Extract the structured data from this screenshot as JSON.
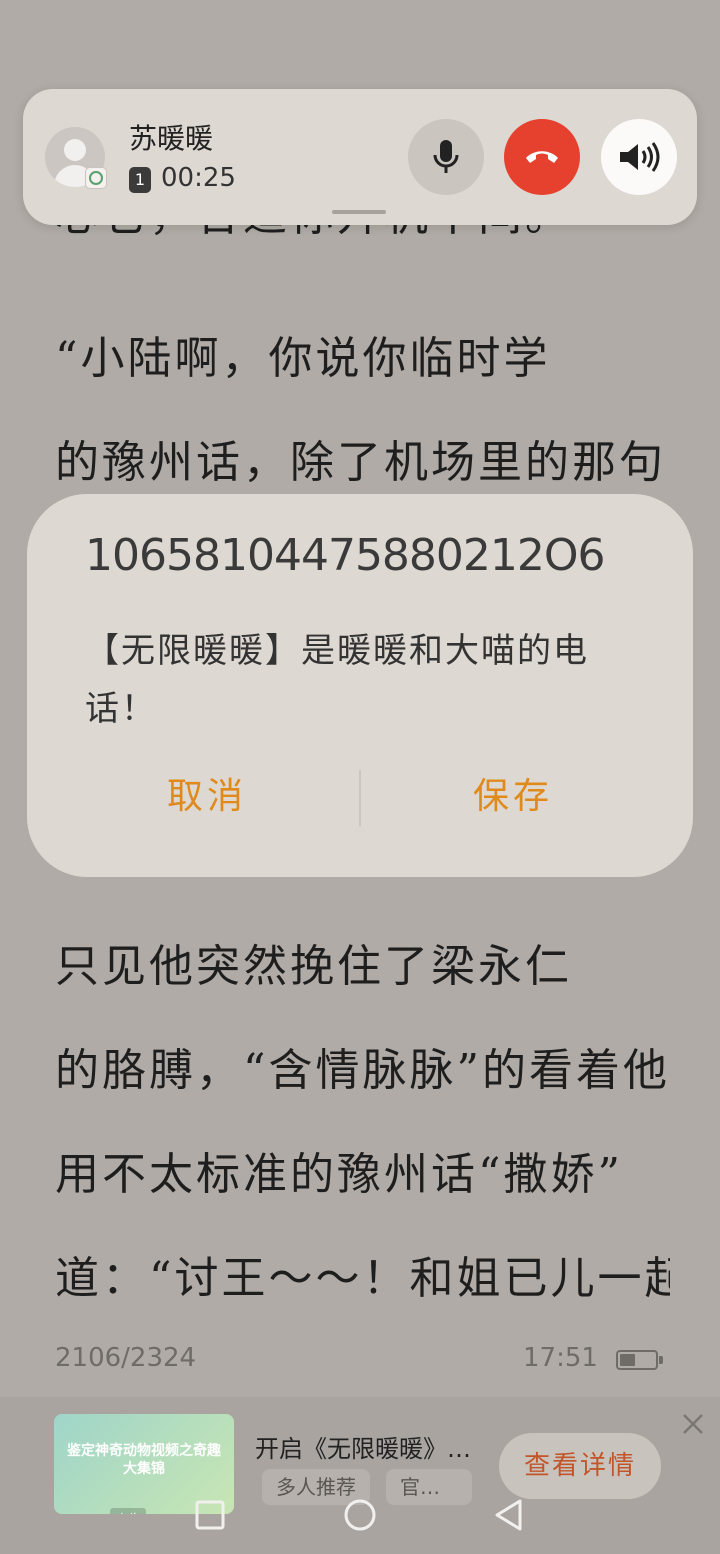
{
  "reader": {
    "line_0": "心它，合适你升机中间。",
    "line_1": "  “小陆啊，你说你临时学",
    "line_2": "的豫州话，除了机场里的那句，",
    "line_3": "  只见他突然挽住了梁永仁",
    "line_4": "的胳膊，“含情脉脉”的看着他，",
    "line_5": "用不太标准的豫州话“撒娇”",
    "line_6": "道：“讨王～～！和姐已儿一起"
  },
  "call": {
    "caller_name": "苏暖暖",
    "sim_slot": "1",
    "timer": "00:25",
    "icons": [
      "avatar-icon",
      "microphone-icon",
      "hang-up-icon",
      "speaker-icon"
    ],
    "hangup_color": "#e6412e"
  },
  "dialog": {
    "number": "10658104475880212O6",
    "message": "【无限暖暖】是暖暖和大喵的电话！",
    "cancel_label": "取消",
    "save_label": "保存",
    "accent_color": "#e08a1b"
  },
  "status": {
    "page": "2106/2324",
    "time": "17:51",
    "battery_level": 0.45
  },
  "ad": {
    "thumb_text": "鉴定神奇动物视频之奇趣大集锦",
    "ad_label": "广告",
    "title": "开启《无限暖暖》…",
    "tag1": "多人推荐",
    "tag2": "官…",
    "cta_label": "查看详情"
  }
}
